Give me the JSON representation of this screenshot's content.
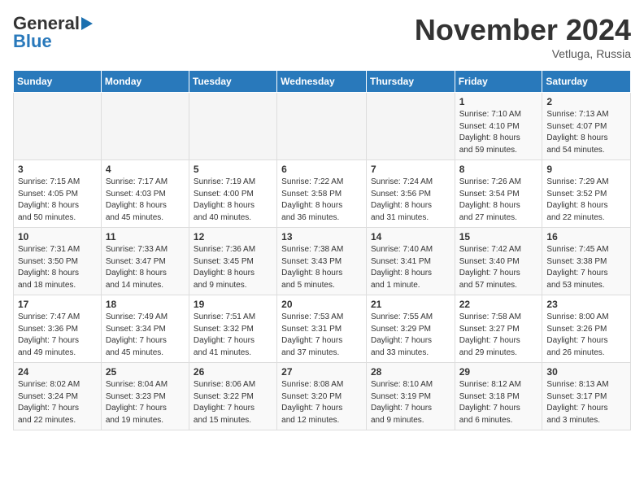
{
  "header": {
    "logo_general": "General",
    "logo_blue": "Blue",
    "month_title": "November 2024",
    "subtitle": "Vetluga, Russia"
  },
  "weekdays": [
    "Sunday",
    "Monday",
    "Tuesday",
    "Wednesday",
    "Thursday",
    "Friday",
    "Saturday"
  ],
  "weeks": [
    [
      {
        "day": "",
        "info": ""
      },
      {
        "day": "",
        "info": ""
      },
      {
        "day": "",
        "info": ""
      },
      {
        "day": "",
        "info": ""
      },
      {
        "day": "",
        "info": ""
      },
      {
        "day": "1",
        "info": "Sunrise: 7:10 AM\nSunset: 4:10 PM\nDaylight: 8 hours\nand 59 minutes."
      },
      {
        "day": "2",
        "info": "Sunrise: 7:13 AM\nSunset: 4:07 PM\nDaylight: 8 hours\nand 54 minutes."
      }
    ],
    [
      {
        "day": "3",
        "info": "Sunrise: 7:15 AM\nSunset: 4:05 PM\nDaylight: 8 hours\nand 50 minutes."
      },
      {
        "day": "4",
        "info": "Sunrise: 7:17 AM\nSunset: 4:03 PM\nDaylight: 8 hours\nand 45 minutes."
      },
      {
        "day": "5",
        "info": "Sunrise: 7:19 AM\nSunset: 4:00 PM\nDaylight: 8 hours\nand 40 minutes."
      },
      {
        "day": "6",
        "info": "Sunrise: 7:22 AM\nSunset: 3:58 PM\nDaylight: 8 hours\nand 36 minutes."
      },
      {
        "day": "7",
        "info": "Sunrise: 7:24 AM\nSunset: 3:56 PM\nDaylight: 8 hours\nand 31 minutes."
      },
      {
        "day": "8",
        "info": "Sunrise: 7:26 AM\nSunset: 3:54 PM\nDaylight: 8 hours\nand 27 minutes."
      },
      {
        "day": "9",
        "info": "Sunrise: 7:29 AM\nSunset: 3:52 PM\nDaylight: 8 hours\nand 22 minutes."
      }
    ],
    [
      {
        "day": "10",
        "info": "Sunrise: 7:31 AM\nSunset: 3:50 PM\nDaylight: 8 hours\nand 18 minutes."
      },
      {
        "day": "11",
        "info": "Sunrise: 7:33 AM\nSunset: 3:47 PM\nDaylight: 8 hours\nand 14 minutes."
      },
      {
        "day": "12",
        "info": "Sunrise: 7:36 AM\nSunset: 3:45 PM\nDaylight: 8 hours\nand 9 minutes."
      },
      {
        "day": "13",
        "info": "Sunrise: 7:38 AM\nSunset: 3:43 PM\nDaylight: 8 hours\nand 5 minutes."
      },
      {
        "day": "14",
        "info": "Sunrise: 7:40 AM\nSunset: 3:41 PM\nDaylight: 8 hours\nand 1 minute."
      },
      {
        "day": "15",
        "info": "Sunrise: 7:42 AM\nSunset: 3:40 PM\nDaylight: 7 hours\nand 57 minutes."
      },
      {
        "day": "16",
        "info": "Sunrise: 7:45 AM\nSunset: 3:38 PM\nDaylight: 7 hours\nand 53 minutes."
      }
    ],
    [
      {
        "day": "17",
        "info": "Sunrise: 7:47 AM\nSunset: 3:36 PM\nDaylight: 7 hours\nand 49 minutes."
      },
      {
        "day": "18",
        "info": "Sunrise: 7:49 AM\nSunset: 3:34 PM\nDaylight: 7 hours\nand 45 minutes."
      },
      {
        "day": "19",
        "info": "Sunrise: 7:51 AM\nSunset: 3:32 PM\nDaylight: 7 hours\nand 41 minutes."
      },
      {
        "day": "20",
        "info": "Sunrise: 7:53 AM\nSunset: 3:31 PM\nDaylight: 7 hours\nand 37 minutes."
      },
      {
        "day": "21",
        "info": "Sunrise: 7:55 AM\nSunset: 3:29 PM\nDaylight: 7 hours\nand 33 minutes."
      },
      {
        "day": "22",
        "info": "Sunrise: 7:58 AM\nSunset: 3:27 PM\nDaylight: 7 hours\nand 29 minutes."
      },
      {
        "day": "23",
        "info": "Sunrise: 8:00 AM\nSunset: 3:26 PM\nDaylight: 7 hours\nand 26 minutes."
      }
    ],
    [
      {
        "day": "24",
        "info": "Sunrise: 8:02 AM\nSunset: 3:24 PM\nDaylight: 7 hours\nand 22 minutes."
      },
      {
        "day": "25",
        "info": "Sunrise: 8:04 AM\nSunset: 3:23 PM\nDaylight: 7 hours\nand 19 minutes."
      },
      {
        "day": "26",
        "info": "Sunrise: 8:06 AM\nSunset: 3:22 PM\nDaylight: 7 hours\nand 15 minutes."
      },
      {
        "day": "27",
        "info": "Sunrise: 8:08 AM\nSunset: 3:20 PM\nDaylight: 7 hours\nand 12 minutes."
      },
      {
        "day": "28",
        "info": "Sunrise: 8:10 AM\nSunset: 3:19 PM\nDaylight: 7 hours\nand 9 minutes."
      },
      {
        "day": "29",
        "info": "Sunrise: 8:12 AM\nSunset: 3:18 PM\nDaylight: 7 hours\nand 6 minutes."
      },
      {
        "day": "30",
        "info": "Sunrise: 8:13 AM\nSunset: 3:17 PM\nDaylight: 7 hours\nand 3 minutes."
      }
    ]
  ]
}
